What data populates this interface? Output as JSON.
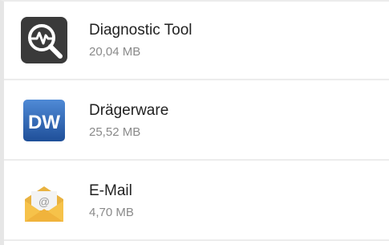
{
  "apps": [
    {
      "name": "Diagnostic Tool",
      "size": "20,04 MB",
      "icon": "diagnostic-tool-icon"
    },
    {
      "name": "Drägerware",
      "size": "25,52 MB",
      "icon": "draegerware-icon",
      "icon_text": "DW"
    },
    {
      "name": "E-Mail",
      "size": "4,70 MB",
      "icon": "email-icon",
      "icon_text": "@"
    }
  ],
  "colors": {
    "diagnostic_bg": "#3a3a3a",
    "dw_blue": "#2f68b7",
    "mail_yellow": "#f4b73a"
  }
}
